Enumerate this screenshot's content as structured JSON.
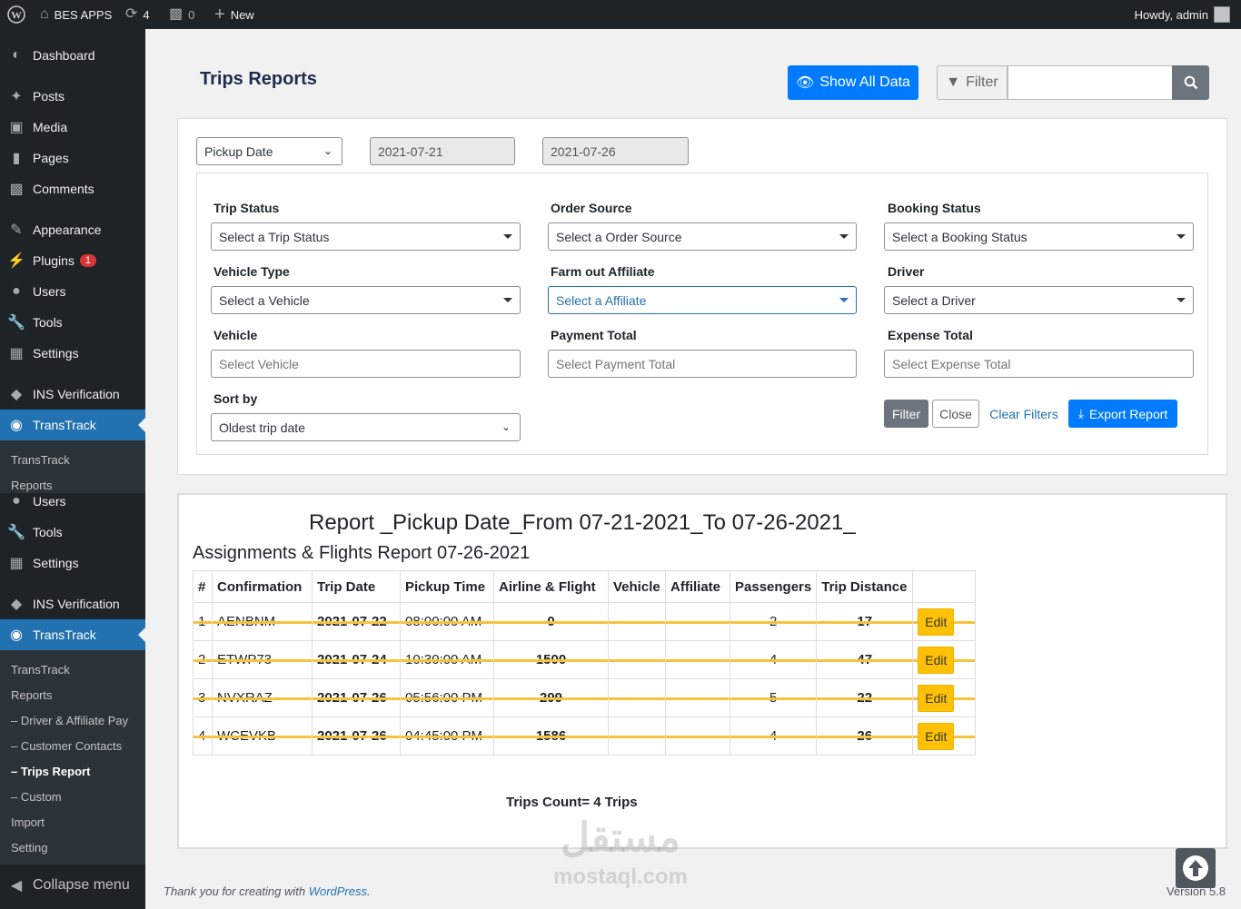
{
  "adminbar": {
    "site_name": "BES APPS",
    "updates_count": "4",
    "comments_count": "0",
    "new_label": "New",
    "howdy": "Howdy, admin"
  },
  "sidebar": {
    "items": [
      {
        "label": "Dashboard",
        "icon": "dashboard-icon"
      },
      {
        "label": "Posts",
        "icon": "pin-icon"
      },
      {
        "label": "Media",
        "icon": "media-icon"
      },
      {
        "label": "Pages",
        "icon": "pages-icon"
      },
      {
        "label": "Comments",
        "icon": "comments-icon"
      },
      {
        "label": "Appearance",
        "icon": "brush-icon"
      },
      {
        "label": "Plugins",
        "icon": "plugin-icon",
        "badge": "1"
      },
      {
        "label": "Users",
        "icon": "users-icon"
      },
      {
        "label": "Tools",
        "icon": "wrench-icon"
      },
      {
        "label": "Settings",
        "icon": "settings-icon"
      },
      {
        "label": "INS Verification",
        "icon": "diamond-icon"
      },
      {
        "label": "TransTrack",
        "icon": "car-icon"
      }
    ],
    "sub1": [
      "TransTrack",
      "Reports"
    ],
    "overlap": [
      {
        "label": "Users"
      },
      {
        "label": "Tools"
      },
      {
        "label": "Settings"
      },
      {
        "label": "INS Verification"
      },
      {
        "label": "TransTrack"
      }
    ],
    "sub2": [
      "TransTrack",
      "Reports",
      "– Driver & Affiliate Pay",
      "– Customer Contacts",
      "– Trips Report",
      "– Custom",
      "Import",
      "Setting"
    ],
    "collapse": "Collapse menu"
  },
  "page": {
    "title": "Trips Reports",
    "show_all": "Show All Data",
    "filter_btn": "Filter"
  },
  "filters": {
    "date_type": "Pickup Date",
    "date_from": "2021-07-21",
    "date_to": "2021-07-26",
    "trip_status_label": "Trip Status",
    "trip_status_ph": "Select a Trip Status",
    "order_source_label": "Order Source",
    "order_source_ph": "Select a Order Source",
    "booking_status_label": "Booking Status",
    "booking_status_ph": "Select a Booking Status",
    "vehicle_type_label": "Vehicle Type",
    "vehicle_type_ph": "Select a Vehicle",
    "farm_out_label": "Farm out Affiliate",
    "farm_out_ph": "Select a Affiliate",
    "driver_label": "Driver",
    "driver_ph": "Select a Driver",
    "vehicle_label": "Vehicle",
    "vehicle_ph": "Select Vehicle",
    "payment_total_label": "Payment Total",
    "payment_total_ph": "Select Payment Total",
    "expense_total_label": "Expense Total",
    "expense_total_ph": "Select Expense Total",
    "sort_label": "Sort by",
    "sort_value": "Oldest trip date",
    "btn_filter": "Filter",
    "btn_close": "Close",
    "btn_clear": "Clear Filters",
    "btn_export": "Export Report"
  },
  "report": {
    "heading": "Report _Pickup Date_From 07-21-2021_To 07-26-2021_",
    "subheading": "Assignments & Flights Report 07-26-2021",
    "columns": [
      "#",
      "Confirmation",
      "Trip Date",
      "Pickup Time",
      "Airline & Flight",
      "Vehicle",
      "Affiliate",
      "Passengers",
      "Trip Distance",
      ""
    ],
    "rows": [
      {
        "num": "1",
        "conf": "AENBNM",
        "date": "2021-07-22",
        "time": "08:00:00 AM",
        "flight": "0",
        "vehicle": "",
        "affiliate": "",
        "pax": "2",
        "dist": "17",
        "edit": "Edit"
      },
      {
        "num": "2",
        "conf": "ETWP73",
        "date": "2021-07-24",
        "time": "10:30:00 AM",
        "flight": "1500",
        "vehicle": "",
        "affiliate": "",
        "pax": "4",
        "dist": "47",
        "edit": "Edit"
      },
      {
        "num": "3",
        "conf": "NVXRAZ",
        "date": "2021-07-26",
        "time": "05:56:00 PM",
        "flight": "299",
        "vehicle": "",
        "affiliate": "",
        "pax": "5",
        "dist": "22",
        "edit": "Edit"
      },
      {
        "num": "4",
        "conf": "WCEVKB",
        "date": "2021-07-26",
        "time": "04:45:00 PM",
        "flight": "1586",
        "vehicle": "",
        "affiliate": "",
        "pax": "4",
        "dist": "26",
        "edit": "Edit"
      }
    ],
    "count": "Trips Count= 4 Trips"
  },
  "footer": {
    "thanks": "Thank you for creating with ",
    "wp_link": "WordPress",
    "period": ".",
    "version": "Version 5.8"
  },
  "watermark": {
    "arabic": "مستقل",
    "latin": "mostaql.com"
  },
  "colors": {
    "primary": "#007bff",
    "wp_blue": "#2271b1",
    "edit_yellow": "#ffc107",
    "strike": "#f6c33b"
  }
}
